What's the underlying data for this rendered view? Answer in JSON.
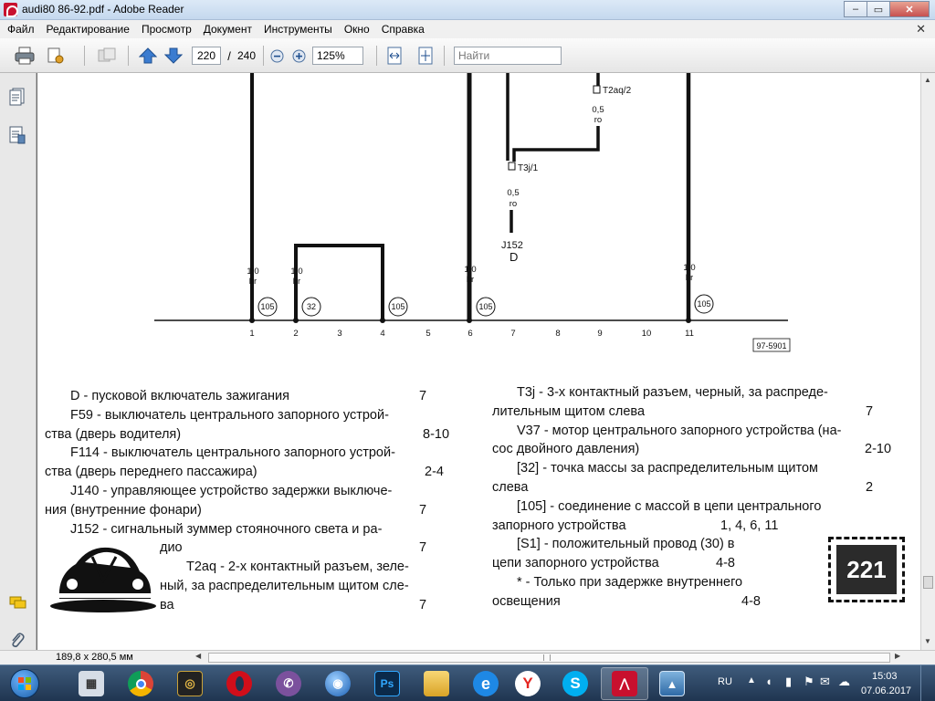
{
  "window": {
    "title": "audi80 86-92.pdf - Adobe Reader",
    "controls": [
      "–",
      "▭",
      "✕"
    ]
  },
  "menu": {
    "items": [
      "Файл",
      "Редактирование",
      "Просмотр",
      "Документ",
      "Инструменты",
      "Окно",
      "Справка"
    ],
    "close_glyph": "✕"
  },
  "toolbar": {
    "current_page": "220",
    "page_separator": "/",
    "total_pages": "240",
    "zoom": "125%",
    "find_placeholder": "Найти"
  },
  "diagram": {
    "wire_labels": [
      {
        "size": "1,0",
        "color": "br"
      },
      {
        "size": "1,0",
        "color": "br"
      },
      {
        "size": "1,0",
        "color": "br"
      },
      {
        "size": "1,0",
        "color": "br"
      }
    ],
    "ground_points": [
      "105",
      "32",
      "105",
      "105",
      "105"
    ],
    "connectors": [
      "T2aq/2",
      "T3j/1"
    ],
    "mid_wires": [
      {
        "size": "0,5",
        "color": "ro"
      },
      {
        "size": "0,5",
        "color": "ro"
      }
    ],
    "component_code": "J152",
    "component_terminal": "D",
    "axis_numbers": [
      "1",
      "2",
      "3",
      "4",
      "5",
      "6",
      "7",
      "8",
      "9",
      "10",
      "11"
    ],
    "drawing_code": "97-5901",
    "page_badge": "221"
  },
  "legend": {
    "left": [
      {
        "text": "D - пусковой включатель зажигания",
        "num": "7"
      },
      {
        "text": "F59 - выключатель центрального запорного устрой-"
      },
      {
        "text": "ства (дверь водителя)",
        "num": "8-10"
      },
      {
        "text": "F114 - выключатель центрального запорного устрой-"
      },
      {
        "text": "ства (дверь переднего пассажира)",
        "num": "2-4"
      },
      {
        "text": "J140 - управляющее устройство задержки выключе-"
      },
      {
        "text": "ния (внутренние фонари)",
        "num": "7"
      },
      {
        "text": "J152 - сигнальный зуммер стояночного света и ра-"
      },
      {
        "text": "дио",
        "num": "7"
      },
      {
        "text": "T2aq - 2-х контактный разъем, зеле-"
      },
      {
        "text": "ный, за распределительным щитом сле-"
      },
      {
        "text": "ва",
        "num": "7"
      }
    ],
    "right": [
      {
        "text": "T3j - 3-х контактный разъем, черный, за распреде-"
      },
      {
        "text": "лительным щитом слева",
        "num": "7"
      },
      {
        "text": "V37 - мотор центрального запорного устройства (на-"
      },
      {
        "text": "сос двойного давления)",
        "num": "2-10"
      },
      {
        "text": "[32] - точка массы за распределительным щитом"
      },
      {
        "text": "слева",
        "num": "2"
      },
      {
        "text": "[105] - соединение с массой в цепи центрального"
      },
      {
        "text": "запорного устройства",
        "num": "1, 4, 6, 11"
      },
      {
        "text": "[S1] - положительный провод (30) в"
      },
      {
        "text": "цепи запорного устройства",
        "num": "4-8"
      },
      {
        "text": "* - Только при задержке внутреннего"
      },
      {
        "text": "освещения",
        "num": "4-8"
      }
    ]
  },
  "statusbar": {
    "page_size": "189,8 x 280,5 мм"
  },
  "taskbar": {
    "apps": [
      "start",
      "calculator",
      "chrome",
      "media",
      "opera",
      "viber",
      "network",
      "photoshop",
      "explorer",
      "ie",
      "yandex",
      "skype",
      "acrobat",
      "photos"
    ],
    "language": "RU",
    "time": "15:03",
    "date": "07.06.2017"
  }
}
